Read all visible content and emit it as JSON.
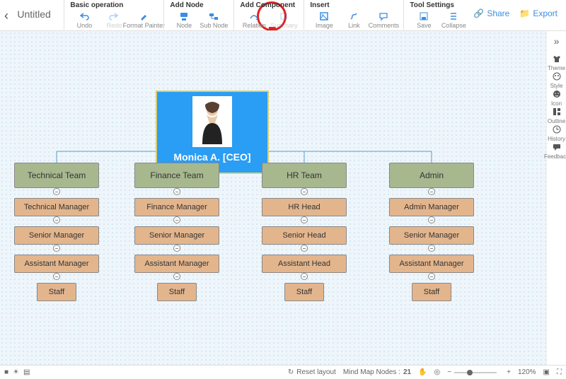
{
  "doc_title": "Untitled",
  "toolbar": {
    "groups": [
      {
        "header": "Basic operation",
        "items": [
          {
            "id": "undo",
            "label": "Undo",
            "icon": "undo"
          },
          {
            "id": "redo",
            "label": "Redo",
            "icon": "redo",
            "disabled": true
          },
          {
            "id": "format-painter",
            "label": "Format Painter",
            "icon": "brush"
          }
        ]
      },
      {
        "header": "Add Node",
        "items": [
          {
            "id": "node",
            "label": "Node",
            "icon": "node"
          },
          {
            "id": "sub-node",
            "label": "Sub Node",
            "icon": "subnode"
          }
        ]
      },
      {
        "header": "Add Component",
        "items": [
          {
            "id": "relation",
            "label": "Relation",
            "icon": "relation"
          },
          {
            "id": "summary",
            "label": "Summary",
            "icon": "summary",
            "disabled": true
          }
        ]
      },
      {
        "header": "Insert",
        "items": [
          {
            "id": "image",
            "label": "Image",
            "icon": "image",
            "highlighted": true
          },
          {
            "id": "link",
            "label": "Link",
            "icon": "link"
          },
          {
            "id": "comments",
            "label": "Comments",
            "icon": "comment"
          }
        ]
      },
      {
        "header": "Tool Settings",
        "items": [
          {
            "id": "save",
            "label": "Save",
            "icon": "save"
          },
          {
            "id": "collapse",
            "label": "Collapse",
            "icon": "collapse"
          }
        ]
      }
    ]
  },
  "top_right": {
    "share": "Share",
    "export": "Export"
  },
  "side_panel": {
    "items": [
      {
        "id": "theme",
        "label": "Theme",
        "icon": "shirt"
      },
      {
        "id": "style",
        "label": "Style",
        "icon": "palette"
      },
      {
        "id": "icon",
        "label": "Icon",
        "icon": "smile"
      },
      {
        "id": "outline",
        "label": "Outline",
        "icon": "layout"
      },
      {
        "id": "history",
        "label": "History",
        "icon": "history"
      },
      {
        "id": "feedback",
        "label": "Feedback",
        "icon": "chat"
      }
    ]
  },
  "status_bar": {
    "reset_layout": "Reset layout",
    "nodes_label": "Mind Map Nodes :",
    "nodes_count": "21",
    "zoom": "120%"
  },
  "org": {
    "root": {
      "name": "Monica A. [CEO]"
    },
    "columns": [
      {
        "dept": "Technical Team",
        "rows": [
          "Technical Manager",
          "Senior Manager",
          "Assistant Manager",
          "Staff"
        ]
      },
      {
        "dept": "Finance Team",
        "rows": [
          "Finance Manager",
          "Senior Manager",
          "Assistant Manager",
          "Staff"
        ]
      },
      {
        "dept": "HR Team",
        "rows": [
          "HR Head",
          "Senior Head",
          "Assistant Head",
          "Staff"
        ]
      },
      {
        "dept": "Admin",
        "rows": [
          "Admin Manager",
          "Senior Manager",
          "Assistant Manager",
          "Staff"
        ]
      }
    ]
  }
}
